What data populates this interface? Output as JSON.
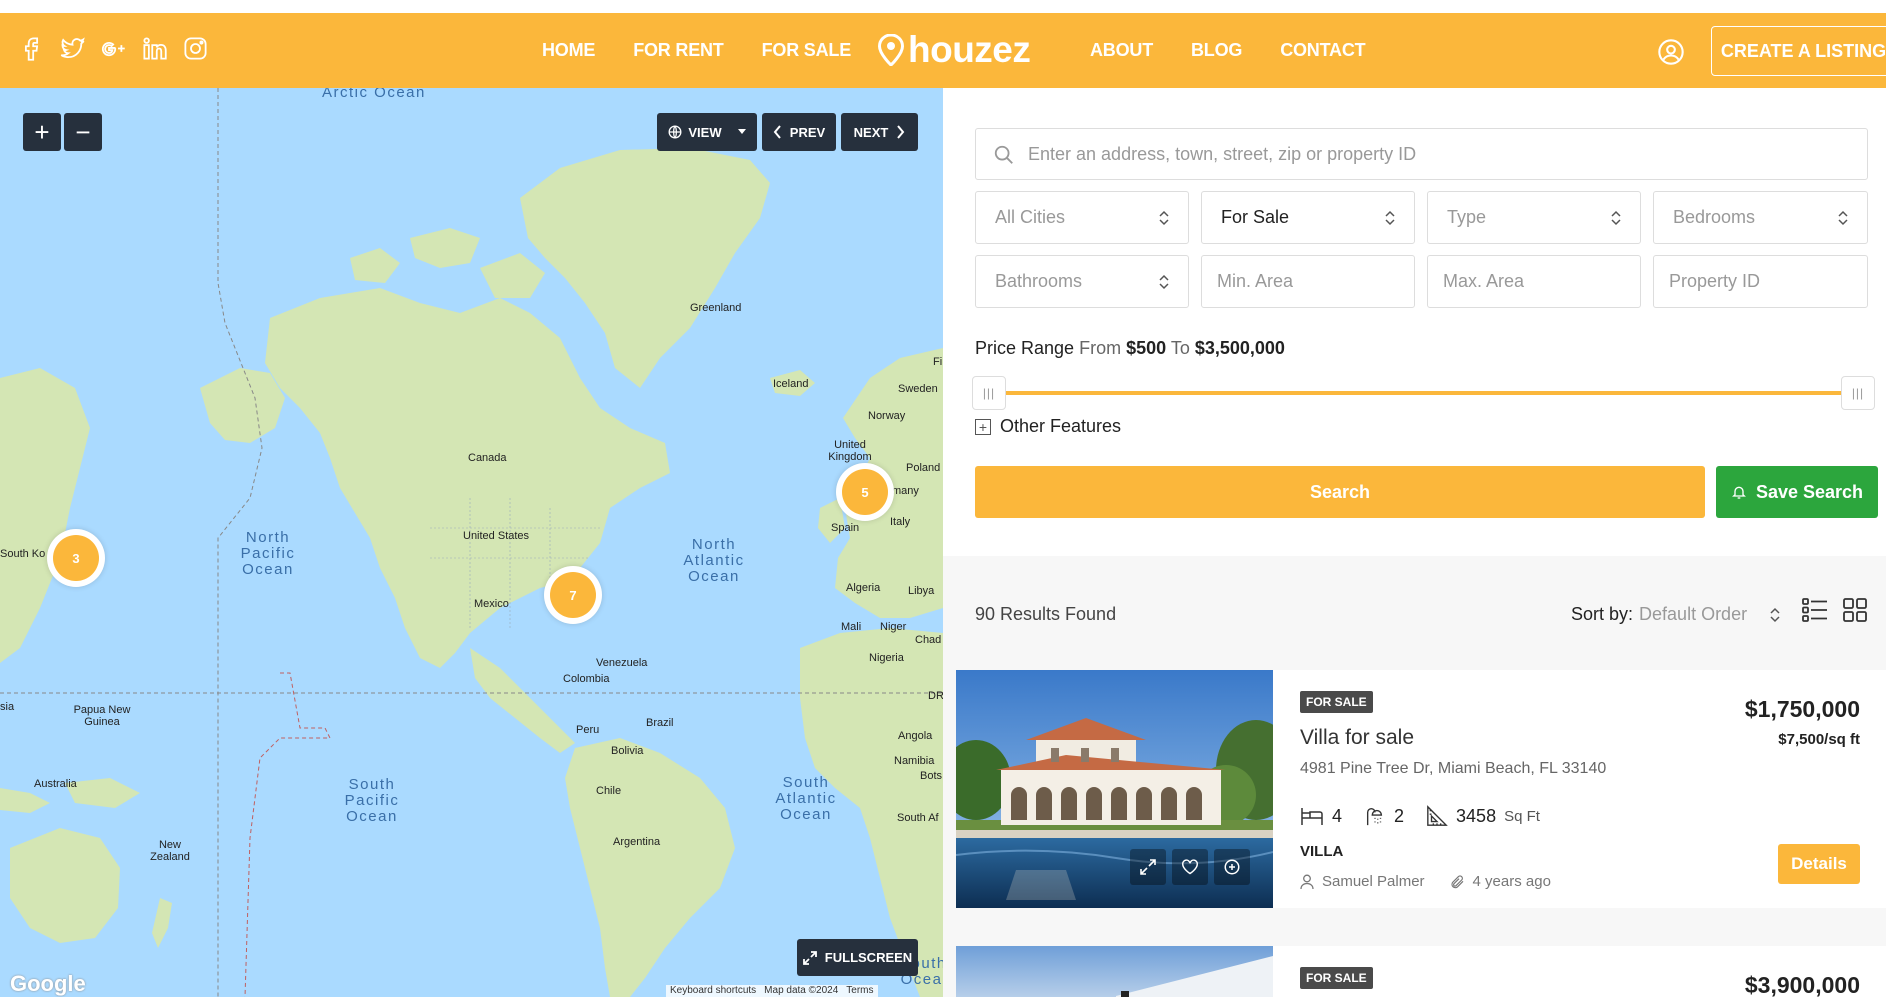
{
  "header": {
    "social": [
      "facebook-icon",
      "twitter-icon",
      "google-plus-icon",
      "linkedin-icon",
      "instagram-icon"
    ],
    "nav_left": [
      "HOME",
      "FOR RENT",
      "FOR SALE"
    ],
    "logo": "houzez",
    "nav_right": [
      "ABOUT",
      "BLOG",
      "CONTACT"
    ],
    "create_listing": "CREATE A LISTING",
    "accent": "#fbb73b"
  },
  "map": {
    "view_label": "VIEW",
    "prev_label": "PREV",
    "next_label": "NEXT",
    "fullscreen_label": "FULLSCREEN",
    "zoom_in": "+",
    "zoom_out": "−",
    "google": "Google",
    "footer": [
      "Keyboard shortcuts",
      "Map data ©2024",
      "Terms"
    ],
    "clusters": [
      "3",
      "7",
      "5"
    ],
    "labels": {
      "arctic": "Arctic Ocean",
      "greenland": "Greenland",
      "iceland": "Iceland",
      "sweden": "Sweden",
      "norway": "Norway",
      "uk": "United Kingdom",
      "poland": "Poland",
      "germany": "many",
      "spain": "Spain",
      "italy": "Italy",
      "canada": "Canada",
      "us": "United States",
      "mexico": "Mexico",
      "venezuela": "Venezuela",
      "colombia": "Colombia",
      "peru": "Peru",
      "brazil": "Brazil",
      "bolivia": "Bolivia",
      "chile": "Chile",
      "argentina": "Argentina",
      "algeria": "Algeria",
      "libya": "Libya",
      "mali": "Mali",
      "niger": "Niger",
      "chad": "Chad",
      "nigeria": "Nigeria",
      "dr": "DR",
      "angola": "Angola",
      "namibia": "Namibia",
      "bots": "Bots",
      "south_afr": "South Af",
      "south_korea": "South Ko",
      "papua": "Papua New Guinea",
      "australia": "Australia",
      "nz": "New Zealand",
      "sia": "sia",
      "fi": "Fi"
    },
    "oceans": {
      "north_pacific": "North Pacific Ocean",
      "north_atlantic": "North Atlantic Ocean",
      "south_pacific": "South Pacific Ocean",
      "south_atlantic": "South Atlantic Ocean",
      "south_ocean": "South Ocea"
    }
  },
  "search": {
    "placeholder": "Enter an address, town, street, zip or property ID",
    "cities": "All Cities",
    "status": "For Sale",
    "type": "Type",
    "bedrooms": "Bedrooms",
    "bathrooms": "Bathrooms",
    "min_area": "Min. Area",
    "max_area": "Max. Area",
    "property_id": "Property ID",
    "price_label": "Price Range",
    "from_word": "From",
    "price_from": "$500",
    "to_word": "To",
    "price_to": "$3,500,000",
    "other_features": "Other Features",
    "search_btn": "Search",
    "save_btn": "Save Search"
  },
  "results": {
    "count": "90 Results Found",
    "sort_label": "Sort by:",
    "sort_value": "Default Order"
  },
  "listings": [
    {
      "badge": "FOR SALE",
      "title": "Villa for sale",
      "address": "4981 Pine Tree Dr, Miami Beach, FL 33140",
      "price": "$1,750,000",
      "per_sqft": "$7,500/sq ft",
      "beds": "4",
      "baths": "2",
      "area": "3458",
      "area_unit": "Sq Ft",
      "type": "VILLA",
      "agent": "Samuel Palmer",
      "age": "4 years ago",
      "details_btn": "Details"
    },
    {
      "badge": "FOR SALE",
      "price": "$3,900,000"
    }
  ]
}
